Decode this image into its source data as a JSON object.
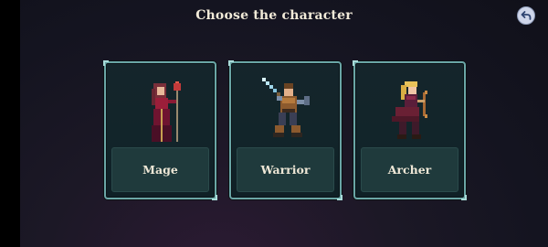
{
  "screen": {
    "title": "Choose the character"
  },
  "back_button": {
    "icon": "back-arrow-icon"
  },
  "characters": [
    {
      "label": "Mage"
    },
    {
      "label": "Warrior"
    },
    {
      "label": "Archer"
    }
  ]
}
